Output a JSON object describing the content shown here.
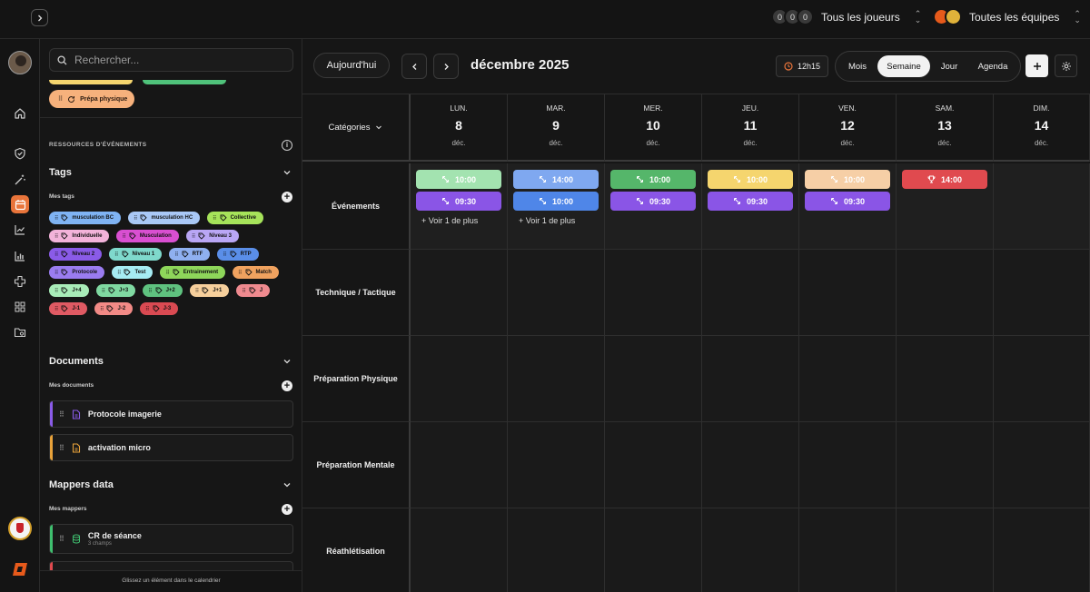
{
  "topbar": {
    "players_avatars": [
      "0",
      "0",
      "0"
    ],
    "players_label": "Tous les joueurs",
    "teams_label": "Toutes les équipes"
  },
  "sidebar": {
    "search_placeholder": "Rechercher...",
    "prep_pill_label": "Prépa physique",
    "resources_title": "RESSOURCES D'ÉVÉNEMENTS",
    "tags_title": "Tags",
    "my_tags_label": "Mes tags",
    "tags": [
      {
        "label": "musculation BC",
        "color": "#7fb3f3"
      },
      {
        "label": "musculation HC",
        "color": "#a9c8f6"
      },
      {
        "label": "Collective",
        "color": "#a6e35a"
      },
      {
        "label": "Individuelle",
        "color": "#f3b3da"
      },
      {
        "label": "Musculation",
        "color": "#d94fd1"
      },
      {
        "label": "Niveau 3",
        "color": "#b9a6f5"
      },
      {
        "label": "Niveau 2",
        "color": "#8a5be8"
      },
      {
        "label": "Niveau 1",
        "color": "#7fd9cc"
      },
      {
        "label": "RTF",
        "color": "#8fb0f0"
      },
      {
        "label": "RTP",
        "color": "#5a8ee8"
      },
      {
        "label": "Protocole",
        "color": "#9a7cf0"
      },
      {
        "label": "Test",
        "color": "#a6ecf3"
      },
      {
        "label": "Entrainement",
        "color": "#8ed65a"
      },
      {
        "label": "Match",
        "color": "#f0a25f"
      },
      {
        "label": "J+4",
        "color": "#a8ecb8"
      },
      {
        "label": "J+3",
        "color": "#7fd9a1"
      },
      {
        "label": "J+2",
        "color": "#5fc27f"
      },
      {
        "label": "J+1",
        "color": "#f6cf9c"
      },
      {
        "label": "J",
        "color": "#ef8a8f"
      },
      {
        "label": "J-1",
        "color": "#e05a63"
      },
      {
        "label": "J-2",
        "color": "#f28a86"
      },
      {
        "label": "J-3",
        "color": "#d94a52"
      }
    ],
    "documents_title": "Documents",
    "my_documents_label": "Mes documents",
    "documents": [
      {
        "label": "Protocole imagerie",
        "color": "#8a5be8"
      },
      {
        "label": "activation micro",
        "color": "#e8a23a"
      }
    ],
    "mappers_title": "Mappers data",
    "my_mappers_label": "Mes mappers",
    "mappers": [
      {
        "label": "CR de séance",
        "sub": "3 champs",
        "color": "#3fbf6f"
      }
    ],
    "footer_hint": "Glissez un élément dans le calendrier"
  },
  "calendar": {
    "today_label": "Aujourd'hui",
    "month_title": "décembre 2025",
    "time_badge": "12h15",
    "views": [
      "Mois",
      "Semaine",
      "Jour",
      "Agenda"
    ],
    "active_view": "Semaine",
    "categories_label": "Catégories",
    "days": [
      {
        "name": "LUN.",
        "num": "8",
        "month": "déc."
      },
      {
        "name": "MAR.",
        "num": "9",
        "month": "déc."
      },
      {
        "name": "MER.",
        "num": "10",
        "month": "déc."
      },
      {
        "name": "JEU.",
        "num": "11",
        "month": "déc."
      },
      {
        "name": "VEN.",
        "num": "12",
        "month": "déc."
      },
      {
        "name": "SAM.",
        "num": "13",
        "month": "déc."
      },
      {
        "name": "DIM.",
        "num": "14",
        "month": "déc."
      }
    ],
    "rows": [
      "Événements",
      "Technique / Tactique",
      "Préparation Physique",
      "Préparation Mentale",
      "Réathlétisation"
    ],
    "events": [
      {
        "day": 0,
        "time": "10:00",
        "color": "#a3e3b0",
        "text_color": "#ffffff",
        "icon": "expand-icon"
      },
      {
        "day": 0,
        "time": "09:30",
        "color": "#8a55e6",
        "text_color": "#ffffff",
        "icon": "expand-icon"
      },
      {
        "day": 1,
        "time": "14:00",
        "color": "#7fa8f0",
        "text_color": "#ffffff",
        "icon": "expand-icon"
      },
      {
        "day": 1,
        "time": "10:00",
        "color": "#4f86e8",
        "text_color": "#ffffff",
        "icon": "expand-icon"
      },
      {
        "day": 2,
        "time": "10:00",
        "color": "#55b66a",
        "text_color": "#ffffff",
        "icon": "expand-icon"
      },
      {
        "day": 2,
        "time": "09:30",
        "color": "#8a55e6",
        "text_color": "#ffffff",
        "icon": "expand-icon"
      },
      {
        "day": 3,
        "time": "10:00",
        "color": "#f5d56e",
        "text_color": "#ffffff",
        "icon": "expand-icon"
      },
      {
        "day": 3,
        "time": "09:30",
        "color": "#8a55e6",
        "text_color": "#ffffff",
        "icon": "expand-icon"
      },
      {
        "day": 4,
        "time": "10:00",
        "color": "#f6cfa6",
        "text_color": "#ffffff",
        "icon": "expand-icon"
      },
      {
        "day": 4,
        "time": "09:30",
        "color": "#8a55e6",
        "text_color": "#ffffff",
        "icon": "expand-icon"
      },
      {
        "day": 5,
        "time": "14:00",
        "color": "#e04a4f",
        "text_color": "#ffffff",
        "icon": "trophy-icon"
      }
    ],
    "more_labels": [
      {
        "day": 0,
        "label": "+ Voir 1 de plus"
      },
      {
        "day": 1,
        "label": "+ Voir 1 de plus"
      }
    ]
  }
}
